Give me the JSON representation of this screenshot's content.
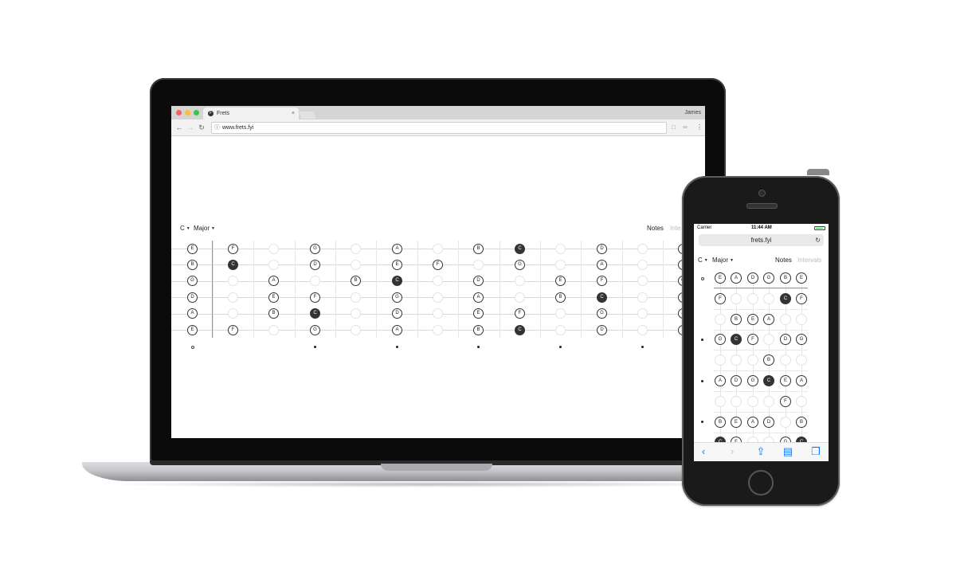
{
  "browser": {
    "tab_title": "Frets",
    "tab_favicon": "F",
    "tab_close": "×",
    "profile_name": "James",
    "url": "www.frets.fyi",
    "icons": [
      "back-arrow-icon",
      "forward-arrow-icon",
      "reload-icon",
      "info-icon",
      "bookmark-icon",
      "extension-icon",
      "menu-dots-icon"
    ]
  },
  "laptop_page": {
    "key": "C",
    "scale": "Major",
    "view_notes": "Notes",
    "view_intervals": "Inte",
    "fretboard": {
      "strings": [
        [
          "E",
          "F",
          "",
          "G",
          "",
          "A",
          "",
          "B",
          "C",
          "",
          "D",
          "",
          "E"
        ],
        [
          "B",
          "C",
          "",
          "D",
          "",
          "E",
          "F",
          "",
          "G",
          "",
          "A",
          "",
          "B"
        ],
        [
          "G",
          "",
          "A",
          "",
          "B",
          "C",
          "",
          "D",
          "",
          "E",
          "F",
          "",
          "G"
        ],
        [
          "D",
          "",
          "E",
          "F",
          "",
          "G",
          "",
          "A",
          "",
          "B",
          "C",
          "",
          "D"
        ],
        [
          "A",
          "",
          "B",
          "C",
          "",
          "D",
          "",
          "E",
          "F",
          "",
          "G",
          "",
          "A"
        ],
        [
          "E",
          "F",
          "",
          "G",
          "",
          "A",
          "",
          "B",
          "C",
          "",
          "D",
          "",
          "E"
        ]
      ],
      "markers": [
        "open",
        "",
        "",
        "dot",
        "",
        "dot",
        "",
        "dot",
        "",
        "dot",
        "",
        "dot"
      ]
    }
  },
  "phone": {
    "carrier": "Carrier",
    "time": "11:44 AM",
    "url": "frets.fyi",
    "key": "C",
    "scale": "Major",
    "view_notes": "Notes",
    "view_intervals": "Intervals",
    "fretboard": {
      "frets": [
        [
          "E",
          "A",
          "D",
          "G",
          "B",
          "E"
        ],
        [
          "F",
          "",
          "",
          "",
          "C",
          "F"
        ],
        [
          "",
          "B",
          "E",
          "A",
          "",
          ""
        ],
        [
          "G",
          "C",
          "F",
          "",
          "D",
          "G"
        ],
        [
          "",
          "",
          "",
          "B",
          "",
          ""
        ],
        [
          "A",
          "D",
          "G",
          "C",
          "E",
          "A"
        ],
        [
          "",
          "",
          "",
          "",
          "F",
          ""
        ],
        [
          "B",
          "E",
          "A",
          "D",
          "",
          "B"
        ],
        [
          "C",
          "F",
          "",
          "",
          "G",
          "C"
        ]
      ],
      "markers": [
        "open",
        "",
        "",
        "dot",
        "",
        "dot",
        "",
        "dot",
        ""
      ]
    },
    "toolbar_icons": [
      "back-icon",
      "forward-icon",
      "share-icon",
      "bookmarks-icon",
      "tabs-icon"
    ]
  }
}
